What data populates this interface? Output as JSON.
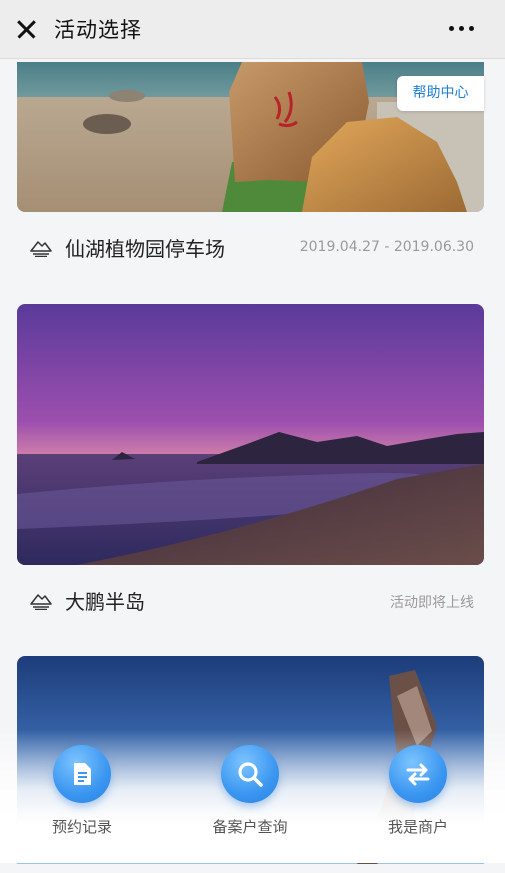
{
  "header": {
    "title": "活动选择",
    "close_icon": "close-icon",
    "more_icon": "more-dots-icon"
  },
  "help": {
    "label": "帮助中心"
  },
  "cards": [
    {
      "name": "仙湖植物园停车场",
      "date": "2019.04.27 - 2019.06.30",
      "icon": "mountain-icon"
    },
    {
      "name": "大鹏半岛",
      "date": "活动即将上线",
      "icon": "mountain-icon"
    }
  ],
  "actions": [
    {
      "label": "预约记录",
      "icon": "document-icon"
    },
    {
      "label": "备案户查询",
      "icon": "search-icon"
    },
    {
      "label": "我是商户",
      "icon": "swap-arrows-icon"
    }
  ],
  "colors": {
    "accent": "#3a96f0",
    "link": "#1f7fd6"
  }
}
